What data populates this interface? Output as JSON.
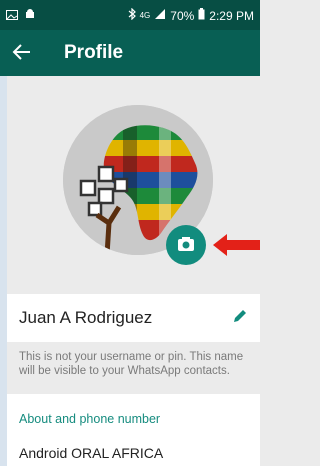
{
  "status_bar": {
    "battery": "70%",
    "time": "2:29 PM",
    "signal_label": "4G"
  },
  "app_bar": {
    "title": "Profile"
  },
  "profile": {
    "name": "Juan A Rodriguez",
    "note": "This is not your username or pin. This name will be visible to your WhatsApp contacts."
  },
  "about": {
    "header": "About and phone number",
    "value": "Android ORAL AFRICA"
  },
  "colors": {
    "status_bar": "#074e44",
    "app_bar": "#085f54",
    "accent": "#128c7e",
    "arrow": "#e32118"
  },
  "icons": {
    "back": "arrow-left-icon",
    "camera": "camera-icon",
    "edit": "pencil-icon"
  }
}
